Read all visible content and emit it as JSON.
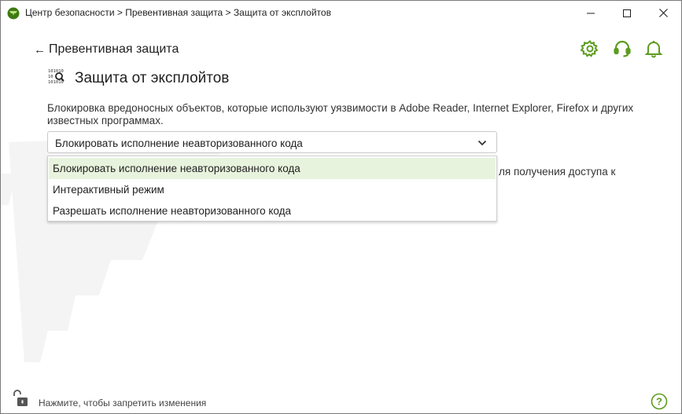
{
  "window": {
    "title": "Центр безопасности > Превентивная защита > Защита от эксплойтов",
    "controls": [
      "minimize-icon",
      "maximize-icon",
      "close-icon"
    ]
  },
  "header": {
    "back_label": "Превентивная защита",
    "icons": [
      "gear-icon",
      "headset-icon",
      "bell-icon"
    ]
  },
  "page": {
    "icon": "exploit-shield-icon",
    "title": "Защита от эксплойтов",
    "description": "Блокировка вредоносных объектов, которые используют уязвимости в Adobe Reader, Internet Explorer, Firefox и других известных программах.",
    "partially_hidden_text": "ля получения доступа к"
  },
  "select": {
    "value": "Блокировать исполнение неавторизованного кода",
    "options": [
      "Блокировать исполнение неавторизованного кода",
      "Интерактивный режим",
      "Разрешать исполнение неавторизованного кода"
    ],
    "selected_index": 0
  },
  "footer": {
    "lock_text": "Нажмите, чтобы запретить изменения",
    "help_icon": "help-icon"
  },
  "colors": {
    "accent": "#5c9c1e",
    "selected_bg": "#e8f3dd",
    "watermark": "#f3f3f3"
  }
}
